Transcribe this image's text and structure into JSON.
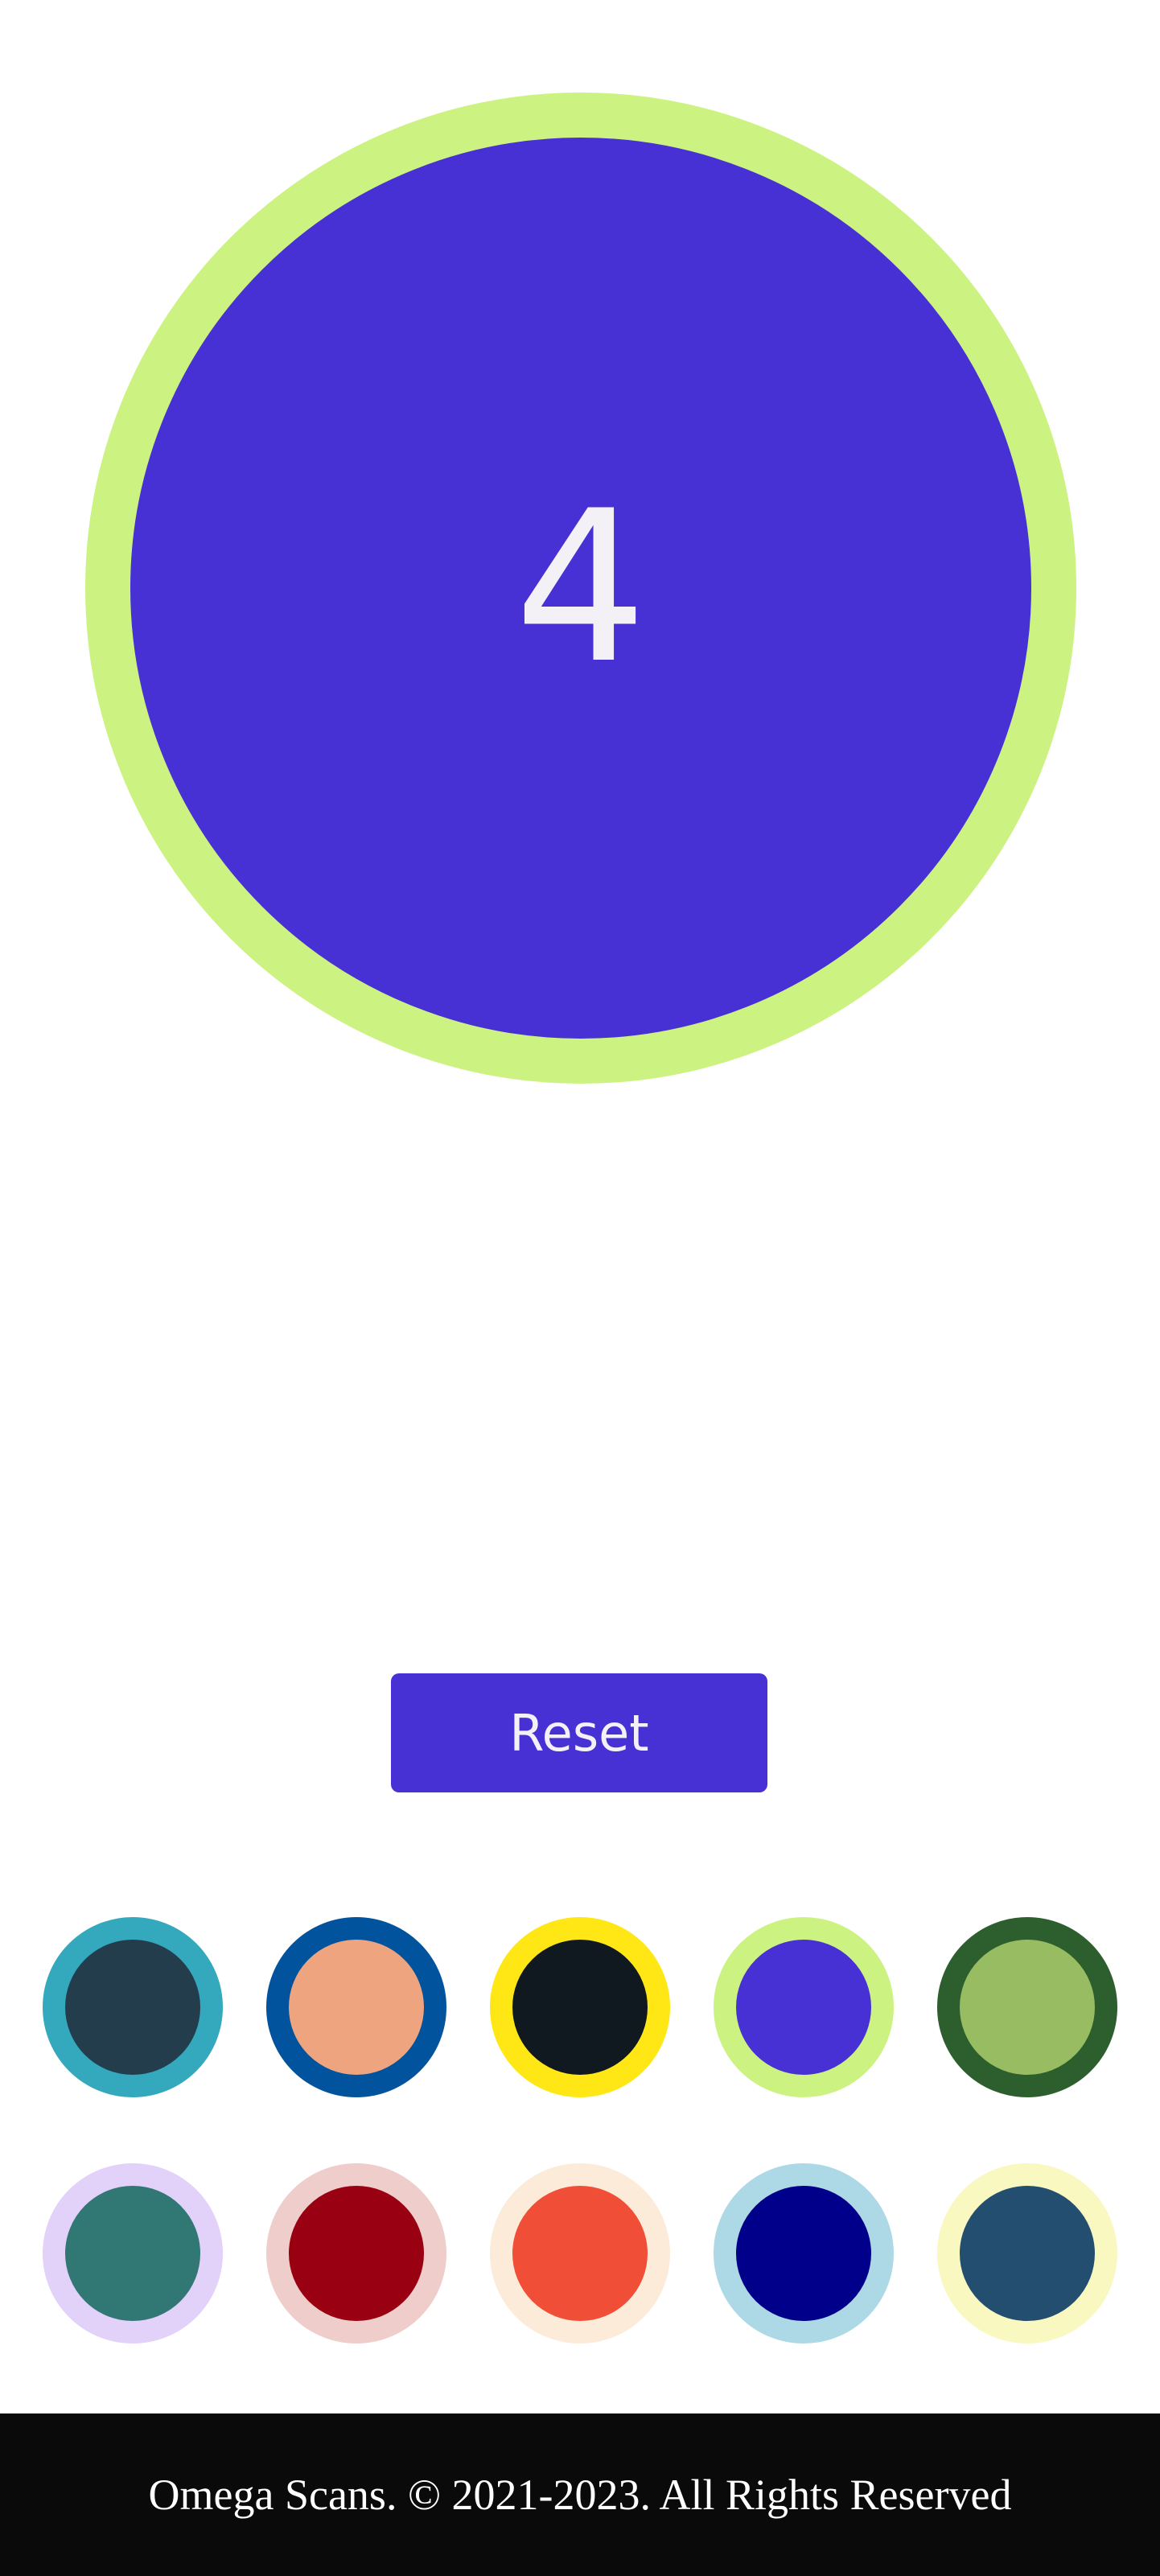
{
  "counter": {
    "value": "4",
    "ring_color": "#ccf381",
    "fill_color": "#4831d4",
    "text_color": "#f3f1f6"
  },
  "reset_button": {
    "label": "Reset",
    "color": "#4831d4"
  },
  "swatches": [
    {
      "ring": "#34a8bd",
      "fill": "#233d4d"
    },
    {
      "ring": "#00539c",
      "fill": "#eea47f"
    },
    {
      "ring": "#fee715",
      "fill": "#101820"
    },
    {
      "ring": "#ccf381",
      "fill": "#4831d4"
    },
    {
      "ring": "#2c5f2d",
      "fill": "#97bc62"
    },
    {
      "ring": "#e2d1f9",
      "fill": "#317773"
    },
    {
      "ring": "#efcdca",
      "fill": "#990011"
    },
    {
      "ring": "#fcebd9",
      "fill": "#f04e36"
    },
    {
      "ring": "#add8e6",
      "fill": "#00008b"
    },
    {
      "ring": "#f9f8c0",
      "fill": "#234e70"
    }
  ],
  "footer": {
    "text": "Omega Scans. © 2021-2023. All Rights Reserved",
    "background": "#0a0a0a"
  }
}
